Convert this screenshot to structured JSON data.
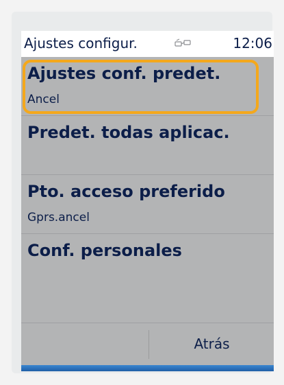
{
  "status_bar": {
    "title": "Ajustes configur.",
    "time": "12:06",
    "icon": "connection-icon"
  },
  "list": {
    "items": [
      {
        "title": "Ajustes conf. predet.",
        "subtitle": "Ancel",
        "selected": true
      },
      {
        "title": "Predet. todas aplicac.",
        "subtitle": "",
        "selected": false
      },
      {
        "title": "Pto. acceso preferido",
        "subtitle": "Gprs.ancel",
        "selected": false
      },
      {
        "title": "Conf. personales",
        "subtitle": "",
        "selected": false
      }
    ]
  },
  "softkeys": {
    "left": "",
    "right": "Atrás"
  },
  "colors": {
    "text": "#0c1e49",
    "highlight": "#f4a81c",
    "background": "#b3b4b5",
    "accent_stripe": "#2f74bf"
  }
}
